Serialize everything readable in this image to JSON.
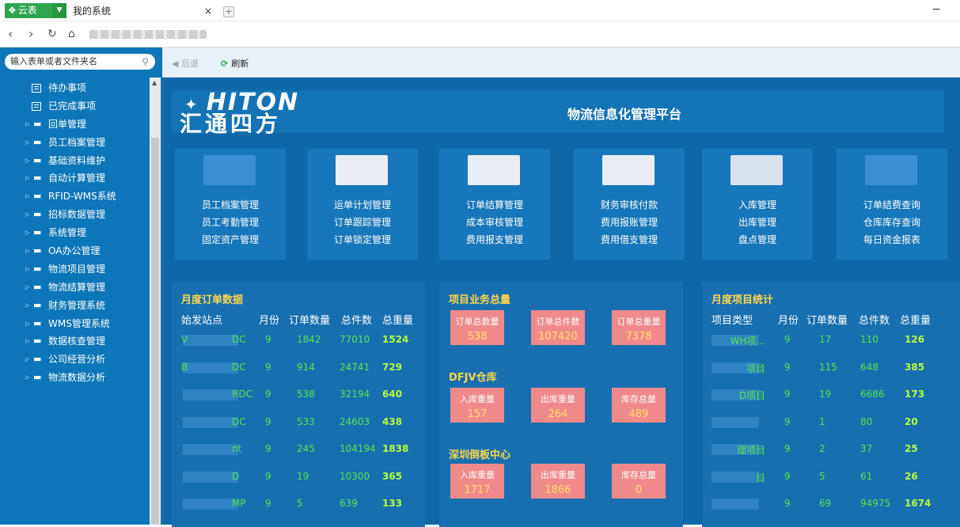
{
  "window": {
    "app_name": "云表",
    "tab_title": "我的系统",
    "tab_close": "×",
    "new_tab": "+",
    "minimize": "−"
  },
  "sidebar": {
    "search_placeholder": "输入表单或者文件夹名",
    "items": [
      {
        "label": "待办事项",
        "type": "doc"
      },
      {
        "label": "已完成事项",
        "type": "doc"
      },
      {
        "label": "回单管理",
        "type": "folder"
      },
      {
        "label": "员工档案管理",
        "type": "folder"
      },
      {
        "label": "基础资料维护",
        "type": "folder"
      },
      {
        "label": "自动计算管理",
        "type": "folder"
      },
      {
        "label": "RFID-WMS系统",
        "type": "folder"
      },
      {
        "label": "招标数据管理",
        "type": "folder"
      },
      {
        "label": "系统管理",
        "type": "folder"
      },
      {
        "label": "OA办公管理",
        "type": "folder"
      },
      {
        "label": "物流项目管理",
        "type": "folder"
      },
      {
        "label": "物流结算管理",
        "type": "folder"
      },
      {
        "label": "财务管理系统",
        "type": "folder"
      },
      {
        "label": "WMS管理系统",
        "type": "folder"
      },
      {
        "label": "数据核查管理",
        "type": "folder"
      },
      {
        "label": "公司经营分析",
        "type": "folder"
      },
      {
        "label": "物流数据分析",
        "type": "folder"
      }
    ]
  },
  "toolbar": {
    "back": "后退",
    "refresh": "刷新"
  },
  "header": {
    "brand_en": "HITON",
    "brand_cn": "汇通四方",
    "platform": "物流信息化管理平台"
  },
  "modules": [
    {
      "icon": "oa-icon",
      "color": "#3a8fd1",
      "links": [
        "员工档案管理",
        "员工考勤管理",
        "固定资产管理"
      ]
    },
    {
      "icon": "plan-icon",
      "color": "#e9eef4",
      "links": [
        "运单计划管理",
        "订单跟踪管理",
        "订单锁定管理"
      ]
    },
    {
      "icon": "settle-icon",
      "color": "#e9eef4",
      "links": [
        "订单结算管理",
        "成本审核管理",
        "费用报支管理"
      ]
    },
    {
      "icon": "finance-icon",
      "color": "#e9eef4",
      "links": [
        "财务审核付款",
        "费用报账管理",
        "费用借支管理"
      ]
    },
    {
      "icon": "warehouse-icon",
      "color": "#d7e2ec",
      "links": [
        "入库管理",
        "出库管理",
        "盘点管理"
      ]
    },
    {
      "icon": "chart-icon",
      "color": "#3a8fd1",
      "links": [
        "订单结费查询",
        "仓库库存查询",
        "每日资金报表"
      ]
    }
  ],
  "monthly_orders": {
    "title": "月度订单数据",
    "headers": [
      "始发站点",
      "月份",
      "订单数量",
      "总件数",
      "总重量"
    ],
    "rows": [
      {
        "site": "V",
        "site_suffix": "DC",
        "month": "9",
        "orders": "1842",
        "pieces": "77010",
        "weight": "1524"
      },
      {
        "site": "B",
        "site_suffix": "DC",
        "month": "9",
        "orders": "914",
        "pieces": "24741",
        "weight": "729"
      },
      {
        "site": "",
        "site_suffix": "RDC",
        "month": "9",
        "orders": "538",
        "pieces": "32194",
        "weight": "640"
      },
      {
        "site": "",
        "site_suffix": "DC",
        "month": "9",
        "orders": "533",
        "pieces": "24603",
        "weight": "438"
      },
      {
        "site": "",
        "site_suffix": "nt",
        "month": "9",
        "orders": "245",
        "pieces": "104194",
        "weight": "1838"
      },
      {
        "site": "",
        "site_suffix": "D",
        "month": "9",
        "orders": "19",
        "pieces": "10300",
        "weight": "365"
      },
      {
        "site": "",
        "site_suffix": "MP",
        "month": "9",
        "orders": "5",
        "pieces": "639",
        "weight": "133"
      }
    ]
  },
  "project_totals": {
    "title": "项目业务总量",
    "boxes": [
      {
        "label": "订单总数量",
        "value": "538"
      },
      {
        "label": "订单总件数",
        "value": "107420"
      },
      {
        "label": "订单总重量",
        "value": "7378"
      }
    ],
    "warehouse1": {
      "title": "DFJV仓库",
      "boxes": [
        {
          "label": "入库重量",
          "value": "157"
        },
        {
          "label": "出库重量",
          "value": "264"
        },
        {
          "label": "库存总量",
          "value": "489"
        }
      ]
    },
    "warehouse2": {
      "title": "深圳倒板中心",
      "boxes": [
        {
          "label": "入库重量",
          "value": "1717"
        },
        {
          "label": "出库重量",
          "value": "1866"
        },
        {
          "label": "库存总量",
          "value": "0"
        }
      ]
    }
  },
  "monthly_projects": {
    "title": "月度项目统计",
    "headers": [
      "项目类型",
      "月份",
      "订单数量",
      "总件数",
      "总重量"
    ],
    "rows": [
      {
        "type": "WH项...",
        "month": "9",
        "orders": "17",
        "pieces": "110",
        "weight": "126"
      },
      {
        "type": "项目",
        "month": "9",
        "orders": "115",
        "pieces": "648",
        "weight": "385"
      },
      {
        "type": "D项目",
        "month": "9",
        "orders": "19",
        "pieces": "6686",
        "weight": "173"
      },
      {
        "type": "",
        "month": "9",
        "orders": "1",
        "pieces": "80",
        "weight": "20"
      },
      {
        "type": "理项目",
        "month": "9",
        "orders": "2",
        "pieces": "37",
        "weight": "25"
      },
      {
        "type": "目",
        "month": "9",
        "orders": "5",
        "pieces": "61",
        "weight": "26"
      },
      {
        "type": "",
        "month": "9",
        "orders": "69",
        "pieces": "94975",
        "weight": "1674"
      }
    ]
  }
}
